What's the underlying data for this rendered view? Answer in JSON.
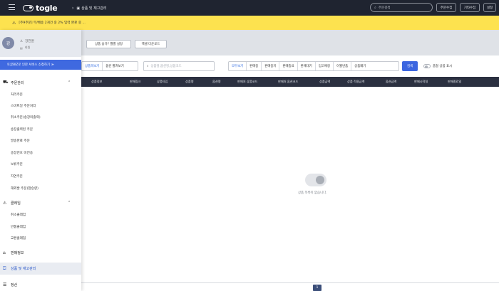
{
  "topbar": {
    "logo_text": "togle",
    "breadcrumb": "상품 및 재고관리",
    "search_placeholder": "주문검색",
    "buttons": [
      "주문수집",
      "기타수집",
      "설정"
    ]
  },
  "notice": {
    "text": "[주9주문] 무/배송 2개건 중 2% 입력 완료 중 ..."
  },
  "strip": {
    "buttons": [
      "상품 송가? 월별 설정",
      "엑셀 다운로드"
    ]
  },
  "toolbar": {
    "view_tabs": [
      "상품목보기",
      "옵션 펼쳐보기"
    ],
    "search_placeholder": "상품명,옵션명,상품코드",
    "filters": [
      "모두보기",
      "판매중",
      "판매중지",
      "판매종료",
      "판매대기",
      "입고예정",
      "이월반품",
      "상품폐기"
    ],
    "search_button": "검색",
    "toggle_label": "품절 상품 표시"
  },
  "table": {
    "headers": [
      "상품정보",
      "판매링크",
      "상품타입",
      "상품명",
      "옵션명",
      "판매처 상품코드",
      "판매처 옵션코드",
      "상품금액",
      "상품 적용금액",
      "옵션금액",
      "판매시작일",
      "판매종료일"
    ]
  },
  "empty_state": {
    "text": "상품 목록이 없습니다."
  },
  "pagination": {
    "current": "1"
  },
  "sidebar": {
    "profile": {
      "avatar_initial": "강",
      "name": "강진원",
      "role": "회원"
    },
    "promo": "토글BIZ로 인한 서비스 신청하기 ≫",
    "sections": [
      {
        "label": "주문관리",
        "icon": "cart-icon",
        "items": [
          "처리주문",
          "스마트일 주문처리",
          "취소주문(송장미출력)",
          "송장출력된 주문",
          "발송완료 주문",
          "송장번호 미전송",
          "보류주문",
          "지연주문",
          "해외발 주문(합승량)"
        ]
      },
      {
        "label": "클레임",
        "icon": "alert-icon",
        "items": [
          "취소클레임",
          "반품클레임",
          "교환클레임"
        ]
      },
      {
        "label": "판매정보",
        "icon": "store-icon",
        "items": []
      },
      {
        "label": "상품 및 재고관리",
        "icon": "box-icon",
        "items": []
      },
      {
        "label": "정산",
        "icon": "list-icon",
        "items": []
      }
    ]
  }
}
